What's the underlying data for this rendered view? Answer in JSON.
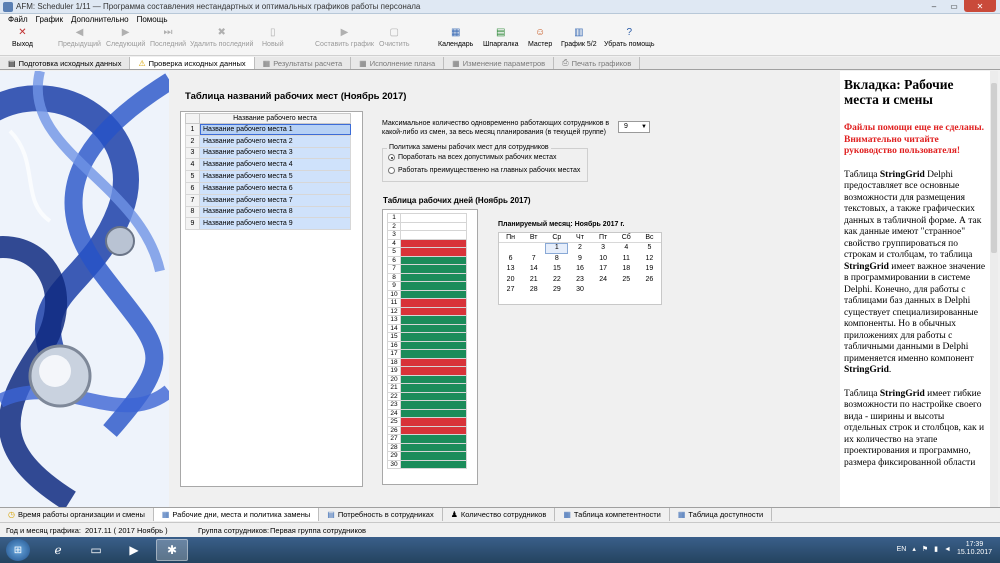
{
  "window": {
    "title": "AFM: Scheduler 1/11 — Программа составления  нестандартных и оптимальных графиков работы персонала",
    "buttons": [
      "–",
      "▭",
      "✕"
    ]
  },
  "menu": [
    "Файл",
    "График",
    "Дополнительно",
    "Помощь"
  ],
  "toolbar": [
    {
      "label": "Выход",
      "icon": "exit-icon",
      "glyph": "✕",
      "enabled": true
    },
    {
      "label": "Предыдущий",
      "icon": "arrow-left-icon",
      "glyph": "◀",
      "enabled": false
    },
    {
      "label": "Следующий",
      "icon": "arrow-right-icon",
      "glyph": "▶",
      "enabled": false
    },
    {
      "label": "Последний",
      "icon": "arrow-last-icon",
      "glyph": "⏭",
      "enabled": false
    },
    {
      "label": "Удалить последний",
      "icon": "delete-icon",
      "glyph": "✖",
      "enabled": false
    },
    {
      "label": "Новый",
      "icon": "new-doc-icon",
      "glyph": "▯",
      "enabled": false
    },
    {
      "label": "Составить график",
      "icon": "compose-icon",
      "glyph": "▶",
      "enabled": false
    },
    {
      "label": "Очистить",
      "icon": "clear-icon",
      "glyph": "▢",
      "enabled": false
    },
    {
      "label": "Календарь",
      "icon": "calendar-icon",
      "glyph": "▦",
      "enabled": true
    },
    {
      "label": "Шпаргалка",
      "icon": "cheatsheet-icon",
      "glyph": "▤",
      "enabled": true
    },
    {
      "label": "Мастер",
      "icon": "wizard-icon",
      "glyph": "☺",
      "enabled": true
    },
    {
      "label": "График 5/2",
      "icon": "schedule-52-icon",
      "glyph": "▥",
      "enabled": true
    },
    {
      "label": "Убрать помощь",
      "icon": "help-icon",
      "glyph": "?",
      "enabled": true
    }
  ],
  "tabs_top": [
    {
      "label": "Подготовка исходных данных",
      "icon": "document-icon",
      "glyph": "▤",
      "state": "normal"
    },
    {
      "label": "Проверка исходных данных",
      "icon": "warning-icon",
      "glyph": "⚠",
      "state": "active"
    },
    {
      "label": "Результаты расчета",
      "icon": "results-icon",
      "glyph": "▦",
      "state": "inactive"
    },
    {
      "label": "Исполнение плана",
      "icon": "plan-icon",
      "glyph": "▦",
      "state": "inactive"
    },
    {
      "label": "Изменение параметров",
      "icon": "params-icon",
      "glyph": "▦",
      "state": "inactive"
    },
    {
      "label": "Печать графиков",
      "icon": "print-icon",
      "glyph": "⎙",
      "state": "inactive"
    }
  ],
  "main": {
    "title": "Таблица названий рабочих мест (Ноябрь 2017)",
    "names_header": "Название рабочего места",
    "names": [
      {
        "n": "1",
        "name": "Название рабочего места 1",
        "selected": true
      },
      {
        "n": "2",
        "name": "Название рабочего места 2"
      },
      {
        "n": "3",
        "name": "Название рабочего места 3"
      },
      {
        "n": "4",
        "name": "Название рабочего места 4"
      },
      {
        "n": "5",
        "name": "Название рабочего места 5"
      },
      {
        "n": "6",
        "name": "Название рабочего места 6"
      },
      {
        "n": "7",
        "name": "Название рабочего места 7"
      },
      {
        "n": "8",
        "name": "Название рабочего места 8"
      },
      {
        "n": "9",
        "name": "Название рабочего места 9"
      }
    ],
    "max_label": "Максимальное количество одновременно работающих сотрудников в какой-либо из смен, за весь месяц планирования (в текущей группе)",
    "max_value": "9",
    "policy_title": "Политика замены рабочих мест для сотрудников",
    "policy_options": [
      {
        "label": "Поработать на всех допустимых рабочих местах",
        "checked": true
      },
      {
        "label": "Работать преимущественно на главных рабочих местах",
        "checked": false
      }
    ],
    "days_title": "Таблица рабочих дней (Ноябрь 2017)",
    "days_colors": {
      "work": "#1b8c5a",
      "off": "#d83339"
    },
    "days": [
      {
        "d": "1",
        "status": "blank"
      },
      {
        "d": "2",
        "status": "blank"
      },
      {
        "d": "3",
        "status": "blank"
      },
      {
        "d": "4",
        "status": "off"
      },
      {
        "d": "5",
        "status": "off"
      },
      {
        "d": "6",
        "status": "work"
      },
      {
        "d": "7",
        "status": "work"
      },
      {
        "d": "8",
        "status": "work"
      },
      {
        "d": "9",
        "status": "work"
      },
      {
        "d": "10",
        "status": "work"
      },
      {
        "d": "11",
        "status": "off"
      },
      {
        "d": "12",
        "status": "off"
      },
      {
        "d": "13",
        "status": "work"
      },
      {
        "d": "14",
        "status": "work"
      },
      {
        "d": "15",
        "status": "work"
      },
      {
        "d": "16",
        "status": "work"
      },
      {
        "d": "17",
        "status": "work"
      },
      {
        "d": "18",
        "status": "off"
      },
      {
        "d": "19",
        "status": "off"
      },
      {
        "d": "20",
        "status": "work"
      },
      {
        "d": "21",
        "status": "work"
      },
      {
        "d": "22",
        "status": "work"
      },
      {
        "d": "23",
        "status": "work"
      },
      {
        "d": "24",
        "status": "work"
      },
      {
        "d": "25",
        "status": "off"
      },
      {
        "d": "26",
        "status": "off"
      },
      {
        "d": "27",
        "status": "work"
      },
      {
        "d": "28",
        "status": "work"
      },
      {
        "d": "29",
        "status": "work"
      },
      {
        "d": "30",
        "status": "work"
      }
    ],
    "planned_month": "Планируемый месяц: Ноябрь  2017 г.",
    "calendar": {
      "dow": [
        "Пн",
        "Вт",
        "Ср",
        "Чт",
        "Пт",
        "Сб",
        "Вс"
      ],
      "weeks": [
        [
          "",
          "",
          "1",
          "2",
          "3",
          "4",
          "5"
        ],
        [
          "6",
          "7",
          "8",
          "9",
          "10",
          "11",
          "12"
        ],
        [
          "13",
          "14",
          "15",
          "16",
          "17",
          "18",
          "19"
        ],
        [
          "20",
          "21",
          "22",
          "23",
          "24",
          "25",
          "26"
        ],
        [
          "27",
          "28",
          "29",
          "30",
          "",
          "",
          ""
        ]
      ],
      "today": "1"
    }
  },
  "help": {
    "title": "Вкладка: Рабочие места и смены",
    "warning": "Файлы помощи еще не сделаны. Внимательно читайте руководство пользователя!",
    "p1_a": "Таблица ",
    "p1_b": "StringGrid",
    "p1_c": " Delphi предоставляет все основные возможности для размещения текстовых, а также графических данных в табличной форме. А так как данные имеют \"странное\" свойство группироваться по строкам и столбцам, то таблица ",
    "p1_d": "StringGrid",
    "p1_e": " имеет важное значение в программировании в системе Delphi. Конечно, для работы с таблицами баз данных в Delphi существует специализированные компоненты. Но в обычных приложениях для работы с табличными данными в Delphi применяется именно компонент ",
    "p1_f": "StringGrid",
    "p1_g": ".",
    "p2_a": "Таблица ",
    "p2_b": "StringGrid",
    "p2_c": " имеет гибкие возможности по настройке своего вида - ширины и высоты отдельных строк и столбцов, как и их количество на этапе проектирования и программно, размера фиксированной области"
  },
  "tabs_bottom": [
    {
      "label": "Время работы организации и смены",
      "icon": "clock-icon",
      "glyph": "◷",
      "active": false
    },
    {
      "label": "Рабочие дни, места и политика замены",
      "icon": "grid-icon",
      "glyph": "▦",
      "active": true
    },
    {
      "label": "Потребность в сотрудниках",
      "icon": "chart-icon",
      "glyph": "▤",
      "active": false
    },
    {
      "label": "Количество сотрудников",
      "icon": "person-icon",
      "glyph": "♟",
      "active": false
    },
    {
      "label": "Таблица компетентности",
      "icon": "table-icon",
      "glyph": "▦",
      "active": false
    },
    {
      "label": "Таблица доступности",
      "icon": "table-icon",
      "glyph": "▦",
      "active": false
    }
  ],
  "status": {
    "label_period": "Год и месяц графика:",
    "value_period": "2017.11  ( 2017  Ноябрь )",
    "label_group": "Группа сотрудников:",
    "value_group": "Первая группа сотрудников"
  },
  "taskbar": {
    "lang": "EN",
    "time": "17:39",
    "date": "15.10.2017"
  }
}
